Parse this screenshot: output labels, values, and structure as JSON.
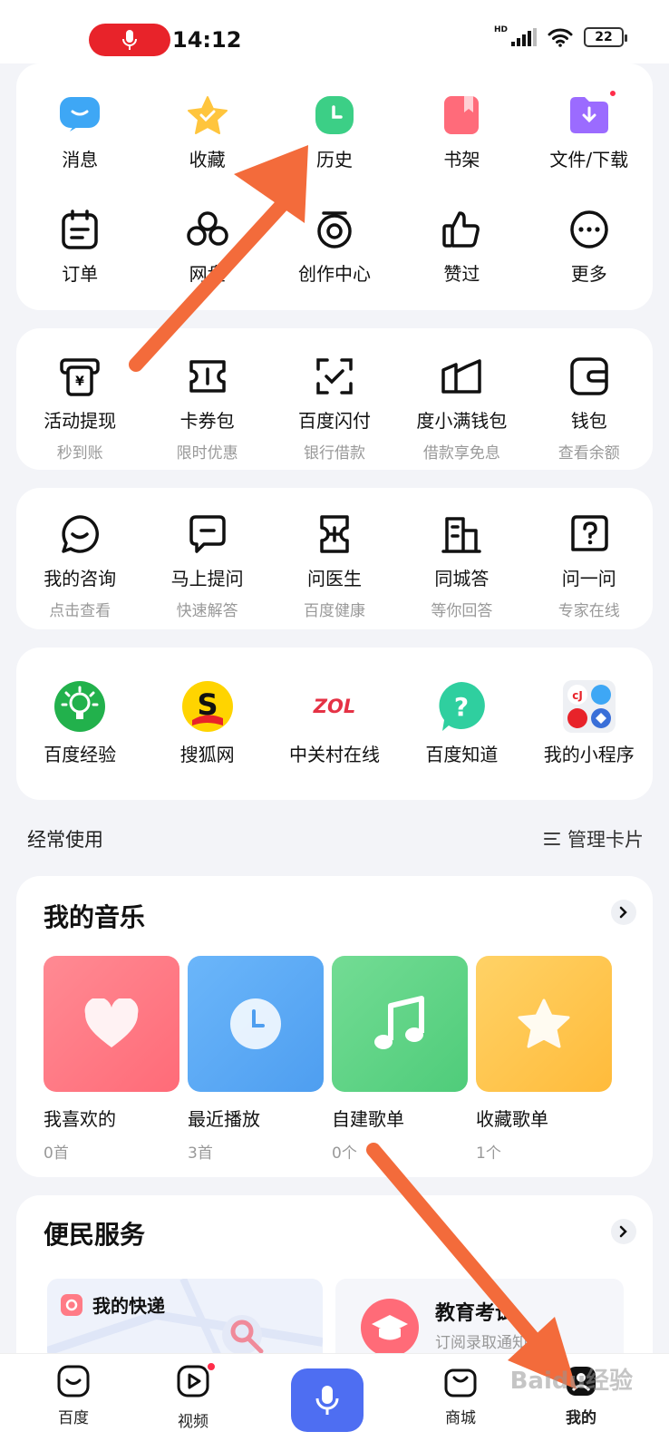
{
  "status_bar": {
    "time": "14:12",
    "network": "HD",
    "battery": "22",
    "mic_icon": "mic-icon"
  },
  "quick_grid": {
    "row1": [
      {
        "label": "消息",
        "icon": "message-icon",
        "color": "#3ea7f5"
      },
      {
        "label": "收藏",
        "icon": "star-icon",
        "color": "#ffc53d"
      },
      {
        "label": "历史",
        "icon": "clock-icon",
        "color": "#3ccf86"
      },
      {
        "label": "书架",
        "icon": "bookshelf-icon",
        "color": "#ff6b7a"
      },
      {
        "label": "文件/下载",
        "icon": "download-folder-icon",
        "color": "#9b6bff"
      }
    ],
    "row2": [
      {
        "label": "订单",
        "icon": "order-icon"
      },
      {
        "label": "网盘",
        "icon": "cloud-disk-icon"
      },
      {
        "label": "创作中心",
        "icon": "creation-icon"
      },
      {
        "label": "赞过",
        "icon": "thumbs-up-icon"
      },
      {
        "label": "更多",
        "icon": "more-icon"
      }
    ]
  },
  "finance": [
    {
      "label": "活动提现",
      "sub": "秒到账",
      "icon": "cash-withdraw-icon"
    },
    {
      "label": "卡券包",
      "sub": "限时优惠",
      "icon": "coupon-icon"
    },
    {
      "label": "百度闪付",
      "sub": "银行借款",
      "icon": "flash-pay-icon"
    },
    {
      "label": "度小满钱包",
      "sub": "借款享免息",
      "icon": "dxm-wallet-icon"
    },
    {
      "label": "钱包",
      "sub": "查看余额",
      "icon": "wallet-icon"
    }
  ],
  "consult": [
    {
      "label": "我的咨询",
      "sub": "点击查看",
      "icon": "consult-icon"
    },
    {
      "label": "马上提问",
      "sub": "快速解答",
      "icon": "ask-icon"
    },
    {
      "label": "问医生",
      "sub": "百度健康",
      "icon": "doctor-icon"
    },
    {
      "label": "同城答",
      "sub": "等你回答",
      "icon": "city-answer-icon"
    },
    {
      "label": "问一问",
      "sub": "专家在线",
      "icon": "question-icon"
    }
  ],
  "mini_programs": [
    {
      "label": "百度经验",
      "icon": "baidu-jingyan-icon",
      "color": "#22b14c"
    },
    {
      "label": "搜狐网",
      "icon": "sohu-icon",
      "color": "#ffd400"
    },
    {
      "label": "中关村在线",
      "icon": "zol-icon",
      "logo_text": "ZOL"
    },
    {
      "label": "百度知道",
      "icon": "baidu-zhidao-icon",
      "color": "#2fcf9f"
    },
    {
      "label": "我的小程序",
      "icon": "mini-programs-icon"
    }
  ],
  "frequent": {
    "title": "经常使用",
    "manage_label": "管理卡片"
  },
  "music": {
    "title": "我的音乐",
    "items": [
      {
        "name": "我喜欢的",
        "count": "0首",
        "icon": "heart-icon",
        "color": "#ff7b86"
      },
      {
        "name": "最近播放",
        "count": "3首",
        "icon": "clock-icon",
        "color": "#5aaaf5"
      },
      {
        "name": "自建歌单",
        "count": "0个",
        "icon": "music-note-icon",
        "color": "#5fd487"
      },
      {
        "name": "收藏歌单",
        "count": "1个",
        "icon": "star-icon",
        "color": "#ffc447"
      }
    ]
  },
  "services": {
    "title": "便民服务",
    "express_label": "我的快递",
    "exam_title": "教育考试",
    "exam_sub": "订阅录取通知"
  },
  "bottom_nav": {
    "items": [
      {
        "label": "百度",
        "icon": "baidu-home-icon"
      },
      {
        "label": "视频",
        "icon": "video-icon"
      },
      {
        "label": "商城",
        "icon": "shop-icon"
      },
      {
        "label": "我的",
        "icon": "profile-icon"
      }
    ],
    "voice_icon": "voice-search-icon"
  },
  "watermark": "Baidu经验",
  "accent_arrow_color": "#f36b3b"
}
